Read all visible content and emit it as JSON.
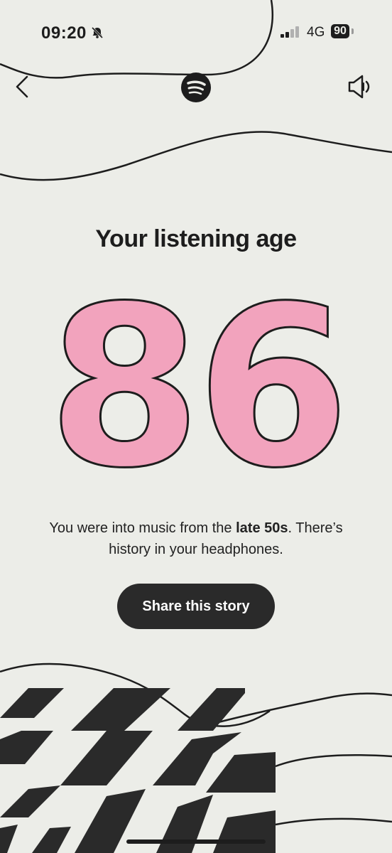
{
  "status_bar": {
    "time": "09:20",
    "network": "4G",
    "battery": "90",
    "silent_icon": "bell-slash-icon",
    "signal_icon": "cellular-signal-icon"
  },
  "header": {
    "back_icon": "chevron-left-icon",
    "logo_icon": "spotify-logo-icon",
    "sound_icon": "speaker-muted-icon"
  },
  "story": {
    "title": "Your listening age",
    "age": "86",
    "description_before": "You were into music from the ",
    "description_bold": "late 50s",
    "description_after": ". There’s history in your headphones.",
    "share_label": "Share this story"
  },
  "colors": {
    "background": "#ECEDE8",
    "accent_pink": "#F2A3BD",
    "ink": "#1D1D1D"
  }
}
